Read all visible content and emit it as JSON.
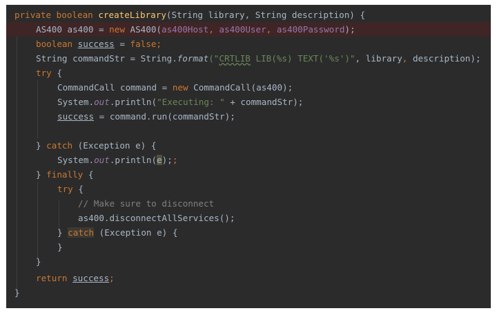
{
  "editor": {
    "language": "java",
    "theme": "darcula",
    "error_line": 2,
    "colors": {
      "background": "#2b2b2b",
      "keyword": "#cc7832",
      "method": "#ffc66d",
      "field": "#9876aa",
      "string": "#6a8759",
      "comment": "#808080",
      "text": "#a9b7c6",
      "error_highlight": "#3f2526"
    },
    "tokens": {
      "l1": [
        "private boolean",
        "createLibrary",
        "(String library, String description) {"
      ],
      "l2": [
        "AS400 as400 = ",
        "new",
        " AS400(",
        "as400Host",
        ", ",
        "as400User",
        ", ",
        "as400Password",
        ");"
      ],
      "l3": [
        "boolean",
        "success",
        " = ",
        "false",
        ";"
      ],
      "l4": [
        "String commandStr = String.",
        "format",
        "(\"",
        "CRTLIB",
        " LIB(%s) TEXT('%s')\"",
        ", library",
        ",",
        " description);"
      ],
      "l5": [
        "try",
        " {"
      ],
      "l6": [
        "CommandCall command = ",
        "new",
        " CommandCall(as400);"
      ],
      "l7": [
        "System.",
        "out",
        ".println(",
        "\"Executing: \"",
        " + commandStr);"
      ],
      "l8": [
        "success",
        " = command.run(commandStr);"
      ],
      "l10": [
        "} ",
        "catch",
        " (Exception e) {"
      ],
      "l11": [
        "System.",
        "out",
        ".println(",
        "e",
        ");",
        ";"
      ],
      "l12": [
        "} ",
        "finally",
        " {"
      ],
      "l13": [
        "try",
        " {"
      ],
      "l14": [
        "// Make sure to disconnect"
      ],
      "l15": [
        "as400.disconnectAllServices();"
      ],
      "l16": [
        "} ",
        "catch",
        " (Exception e) {"
      ],
      "l17": [
        "}"
      ],
      "l18": [
        "}"
      ],
      "l19": [
        "return",
        " ",
        "success",
        ";"
      ],
      "l20": [
        "}"
      ]
    }
  }
}
